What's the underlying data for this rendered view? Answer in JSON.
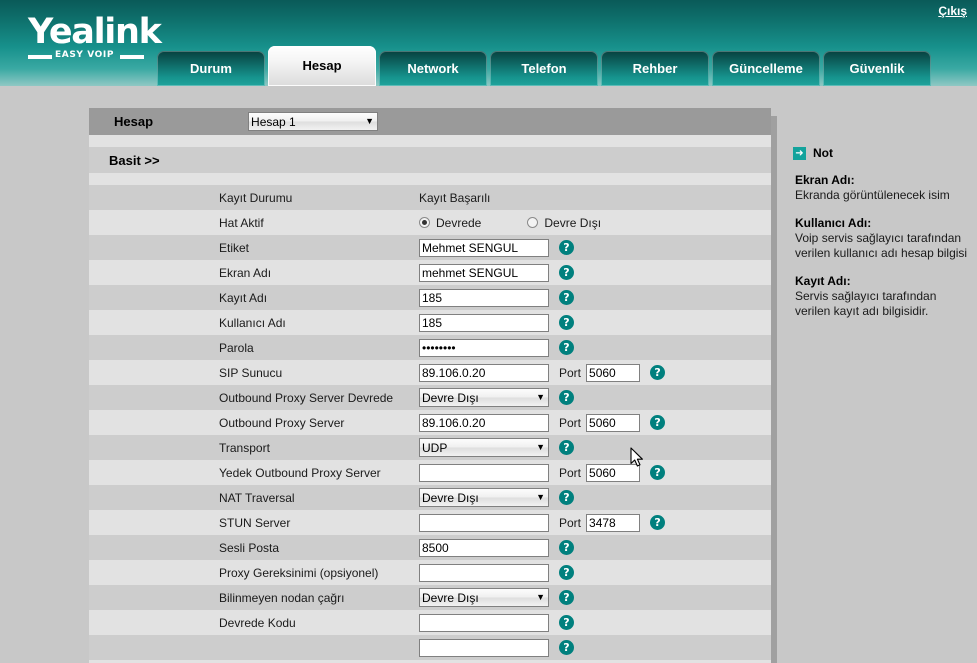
{
  "header": {
    "logo_text": "Yealink",
    "logo_tagline": "EASY VOIP",
    "logout_label": "Çıkış",
    "tabs": [
      {
        "label": "Durum",
        "active": false
      },
      {
        "label": "Hesap",
        "active": true
      },
      {
        "label": "Network",
        "active": false
      },
      {
        "label": "Telefon",
        "active": false
      },
      {
        "label": "Rehber",
        "active": false
      },
      {
        "label": "Güncelleme",
        "active": false
      },
      {
        "label": "Güvenlik",
        "active": false
      }
    ]
  },
  "form": {
    "account_bar_title": "Hesap",
    "account_select_value": "Hesap 1",
    "section_title": "Basit >>",
    "help_glyph": "?",
    "port_label": "Port",
    "dropdown_arrow": "▼",
    "rows": {
      "register_status": {
        "label": "Kayıt Durumu",
        "value": "Kayıt Başarılı"
      },
      "line_active": {
        "label": "Hat Aktif",
        "option_on": "Devrede",
        "option_off": "Devre Dışı",
        "selected": "Devrede"
      },
      "label_field": {
        "label": "Etiket",
        "value": "Mehmet SENGUL"
      },
      "display_name": {
        "label": "Ekran Adı",
        "value": "mehmet SENGUL"
      },
      "register_name": {
        "label": "Kayıt Adı",
        "value": "185"
      },
      "user_name": {
        "label": "Kullanıcı Adı",
        "value": "185"
      },
      "password": {
        "label": "Parola",
        "value": "••••••••"
      },
      "sip_server": {
        "label": "SIP Sunucu",
        "value": "89.106.0.20",
        "port": "5060"
      },
      "outbound_enable": {
        "label": "Outbound Proxy Server Devrede",
        "value": "Devre Dışı"
      },
      "outbound_server": {
        "label": "Outbound Proxy Server",
        "value": "89.106.0.20",
        "port": "5060"
      },
      "transport": {
        "label": "Transport",
        "value": "UDP"
      },
      "backup_outbound": {
        "label": "Yedek Outbound Proxy Server",
        "value": "",
        "port": "5060"
      },
      "nat_traversal": {
        "label": "NAT Traversal",
        "value": "Devre Dışı"
      },
      "stun_server": {
        "label": "STUN Server",
        "value": "",
        "port": "3478"
      },
      "voice_mail": {
        "label": "Sesli Posta",
        "value": "8500"
      },
      "proxy_require": {
        "label": "Proxy Gereksinimi (opsiyonel)",
        "value": ""
      },
      "anonymous_call": {
        "label": "Bilinmeyen nodan çağrı",
        "value": "Devre Dışı"
      },
      "on_code": {
        "label": "Devrede Kodu",
        "value": ""
      }
    }
  },
  "sidebar": {
    "icon_glyph": "➜",
    "title": "Not",
    "notes": [
      {
        "term": "Ekran Adı:",
        "desc": "Ekranda görüntülenecek isim"
      },
      {
        "term": "Kullanıcı Adı:",
        "desc": "Voip servis sağlayıcı tarafından verilen kullanıcı adı hesap bilgisi"
      },
      {
        "term": "Kayıt Adı:",
        "desc": "Servis sağlayıcı tarafından verilen kayıt adı bilgisidir."
      }
    ]
  }
}
